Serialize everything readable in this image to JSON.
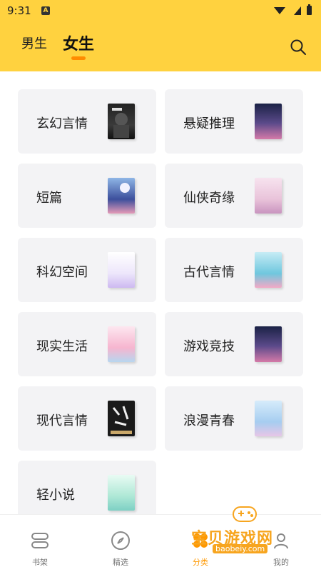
{
  "status_bar": {
    "time": "9:31",
    "notif_badge": "A"
  },
  "header": {
    "tabs": [
      "男生",
      "女生"
    ],
    "active_tab": 1
  },
  "categories": [
    {
      "label": "玄幻言情",
      "cover": "dark-portrait"
    },
    {
      "label": "悬疑推理",
      "cover": "night-sky"
    },
    {
      "label": "短篇",
      "cover": "blue-moon"
    },
    {
      "label": "仙侠奇缘",
      "cover": "pink-fairy"
    },
    {
      "label": "科幻空间",
      "cover": "lavender-script"
    },
    {
      "label": "古代言情",
      "cover": "teal-blossom"
    },
    {
      "label": "现实生活",
      "cover": "pink-flowers"
    },
    {
      "label": "游戏竞技",
      "cover": "night-sky"
    },
    {
      "label": "现代言情",
      "cover": "dark-calligraphy"
    },
    {
      "label": "浪漫青春",
      "cover": "blue-sky"
    },
    {
      "label": "轻小说",
      "cover": "mint-cover"
    }
  ],
  "bottom_nav": [
    {
      "label": "书架",
      "icon": "bookshelf-icon"
    },
    {
      "label": "精选",
      "icon": "compass-icon"
    },
    {
      "label": "分类",
      "icon": "category-icon"
    },
    {
      "label": "我的",
      "icon": "profile-icon"
    }
  ],
  "watermark": {
    "text": "宝贝游戏网",
    "url": "baobeiy.com"
  },
  "colors": {
    "accent": "#FFD23F",
    "indicator": "#FF8C00",
    "card_bg": "#F3F3F5"
  }
}
